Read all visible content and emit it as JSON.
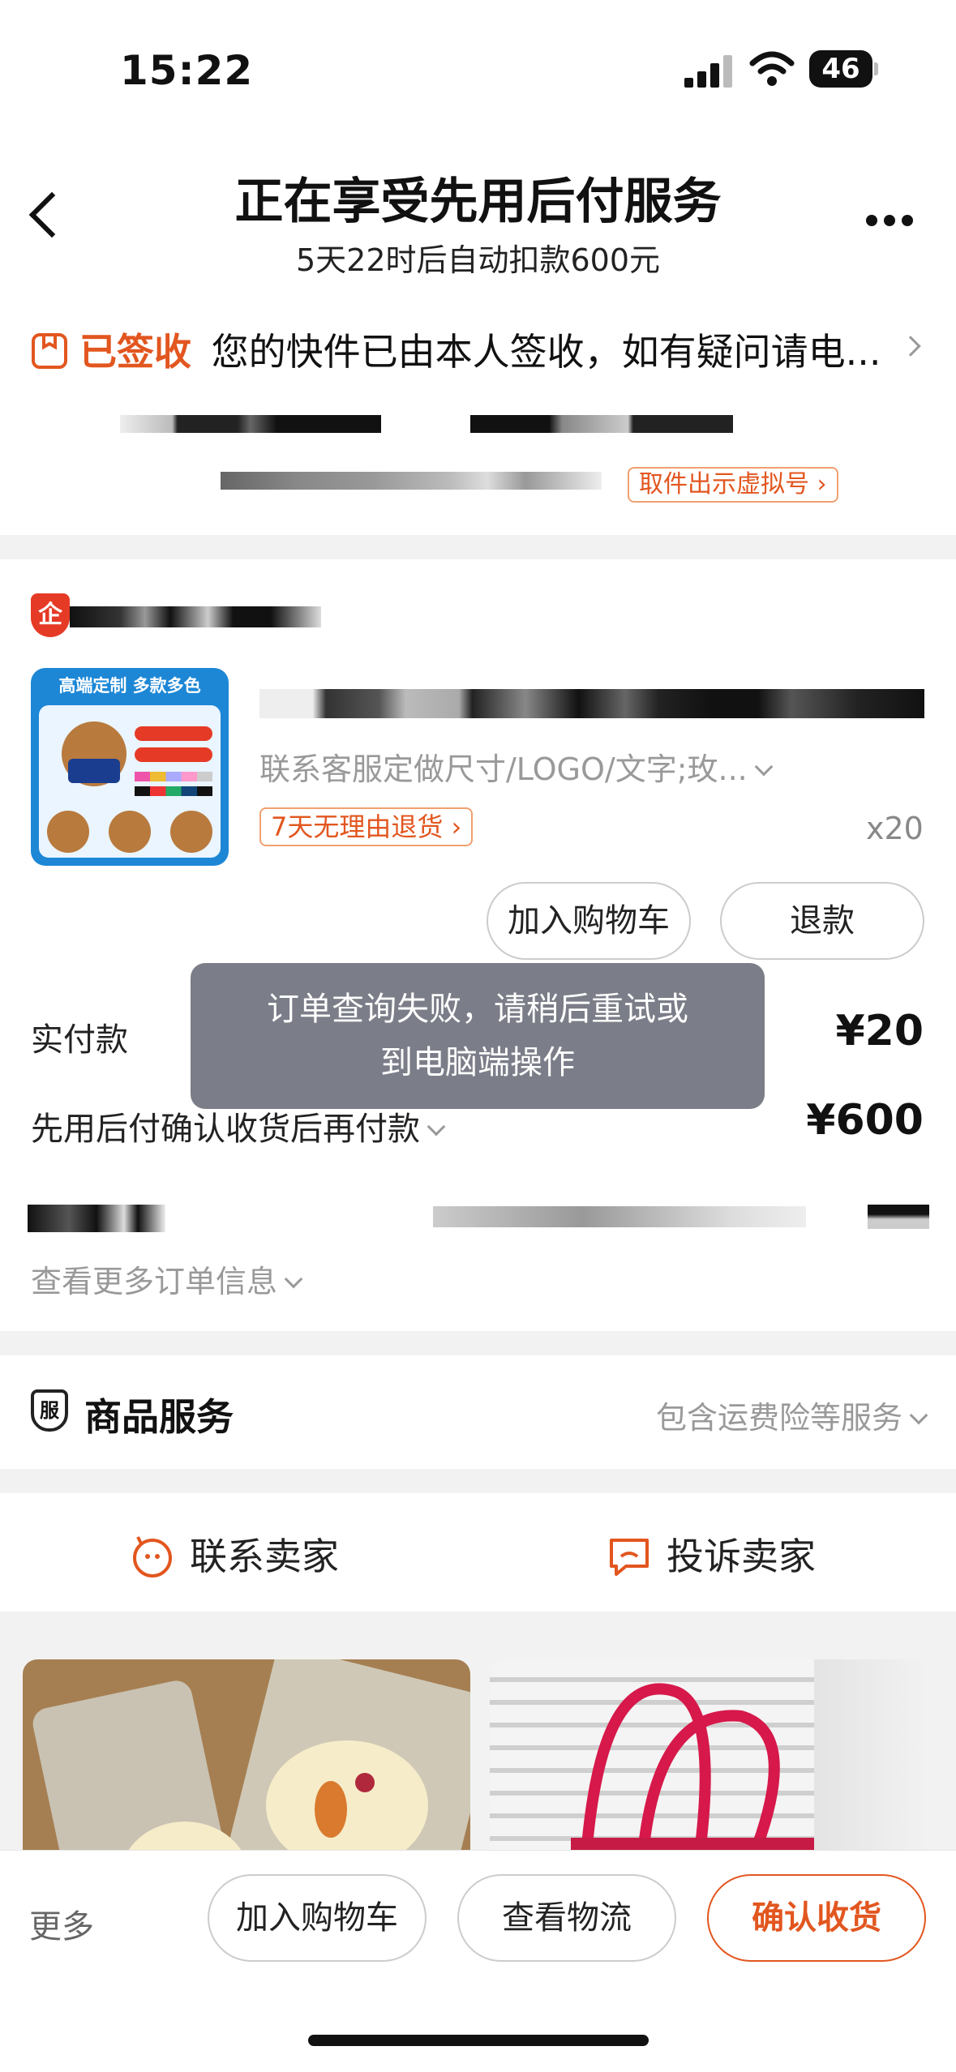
{
  "status_bar": {
    "time": "15:22",
    "battery": "46"
  },
  "header": {
    "title": "正在享受先用后付服务",
    "subtitle": "5天22时后自动扣款600元"
  },
  "delivery": {
    "status": "已签收",
    "message": "您的快件已由本人签收，如有疑问请电...",
    "pickup_button": "取件出示虚拟号"
  },
  "product": {
    "thumb_title": "高端定制 多款多色",
    "spec": "联系客服定做尺寸/LOGO/文字;玫...",
    "return_tag": "7天无理由退货",
    "quantity": "x20",
    "add_cart_button": "加入购物车",
    "refund_button": "退款"
  },
  "payment": {
    "paid_label": "实付款",
    "paid_value": "¥20",
    "bnpl_label": "先用后付确认收货后再付款",
    "bnpl_value": "¥600"
  },
  "toast": {
    "line1": "订单查询失败，请稍后重试或",
    "line2": "到电脑端操作"
  },
  "order_more": "查看更多订单信息",
  "services": {
    "icon_text": "服",
    "title": "商品服务",
    "summary": "包含运费险等服务"
  },
  "contact": {
    "seller": "联系卖家",
    "complain": "投诉卖家"
  },
  "bottom_bar": {
    "more": "更多",
    "add_cart": "加入购物车",
    "logistics": "查看物流",
    "confirm": "确认收货"
  },
  "colors": {
    "accent": "#e2561f",
    "toast_bg": "#7b7e88",
    "shop_badge": "#e53a26"
  }
}
